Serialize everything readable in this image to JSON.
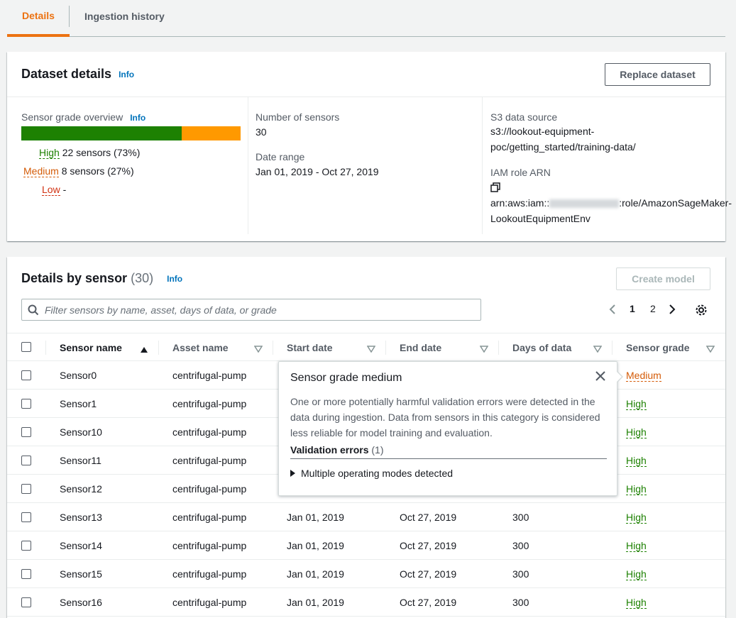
{
  "tabs": [
    {
      "label": "Details",
      "active": true
    },
    {
      "label": "Ingestion history",
      "active": false
    }
  ],
  "dataset": {
    "title": "Dataset details",
    "info": "Info",
    "replace_button": "Replace dataset",
    "grade_overview": {
      "label": "Sensor grade overview",
      "info": "Info",
      "high_fraction": 0.73,
      "medium_fraction": 0.27,
      "high_label": "High",
      "high_value": "22 sensors (73%)",
      "medium_label": "Medium",
      "medium_value": "8 sensors (27%)",
      "low_label": "Low",
      "low_value": "-"
    },
    "num_sensors_label": "Number of sensors",
    "num_sensors": "30",
    "date_range_label": "Date range",
    "date_range": "Jan 01, 2019 - Oct 27, 2019",
    "s3_label": "S3 data source",
    "s3_line1": "s3://lookout-equipment-",
    "s3_line2": "poc/getting_started/training-data/",
    "iam_label": "IAM role ARN",
    "iam_prefix": "arn:aws:iam::",
    "iam_suffix": ":role/AmazonSageMaker-",
    "iam_line2": "LookoutEquipmentEnv"
  },
  "sensors_panel": {
    "title": "Details by sensor",
    "count": "(30)",
    "info": "Info",
    "create_button": "Create model",
    "search_placeholder": "Filter sensors by name, asset, days of data, or grade",
    "pages": [
      "1",
      "2"
    ],
    "current_page": "1",
    "columns": [
      "Sensor name",
      "Asset name",
      "Start date",
      "End date",
      "Days of data",
      "Sensor grade"
    ],
    "rows": [
      {
        "name": "Sensor0",
        "asset": "centrifugal-pump",
        "start": "",
        "end": "",
        "days": "",
        "grade": "Medium"
      },
      {
        "name": "Sensor1",
        "asset": "centrifugal-pump",
        "start": "",
        "end": "",
        "days": "",
        "grade": "High"
      },
      {
        "name": "Sensor10",
        "asset": "centrifugal-pump",
        "start": "",
        "end": "",
        "days": "",
        "grade": "High"
      },
      {
        "name": "Sensor11",
        "asset": "centrifugal-pump",
        "start": "",
        "end": "",
        "days": "",
        "grade": "High"
      },
      {
        "name": "Sensor12",
        "asset": "centrifugal-pump",
        "start": "",
        "end": "",
        "days": "",
        "grade": "High"
      },
      {
        "name": "Sensor13",
        "asset": "centrifugal-pump",
        "start": "Jan 01, 2019",
        "end": "Oct 27, 2019",
        "days": "300",
        "grade": "High"
      },
      {
        "name": "Sensor14",
        "asset": "centrifugal-pump",
        "start": "Jan 01, 2019",
        "end": "Oct 27, 2019",
        "days": "300",
        "grade": "High"
      },
      {
        "name": "Sensor15",
        "asset": "centrifugal-pump",
        "start": "Jan 01, 2019",
        "end": "Oct 27, 2019",
        "days": "300",
        "grade": "High"
      },
      {
        "name": "Sensor16",
        "asset": "centrifugal-pump",
        "start": "Jan 01, 2019",
        "end": "Oct 27, 2019",
        "days": "300",
        "grade": "High"
      }
    ]
  },
  "popover": {
    "title": "Sensor grade medium",
    "body": "One or more potentially harmful validation errors were detected in the data during ingestion. Data from sensors in this category is considered less reliable for model training and evaluation.",
    "errors_label": "Validation errors",
    "errors_count": "(1)",
    "expandable": "Multiple operating modes detected"
  },
  "colors": {
    "accent": "#ec7211",
    "high": "#1d8102",
    "medium": "#ff9900",
    "low": "#d13212",
    "link": "#0073bb"
  }
}
